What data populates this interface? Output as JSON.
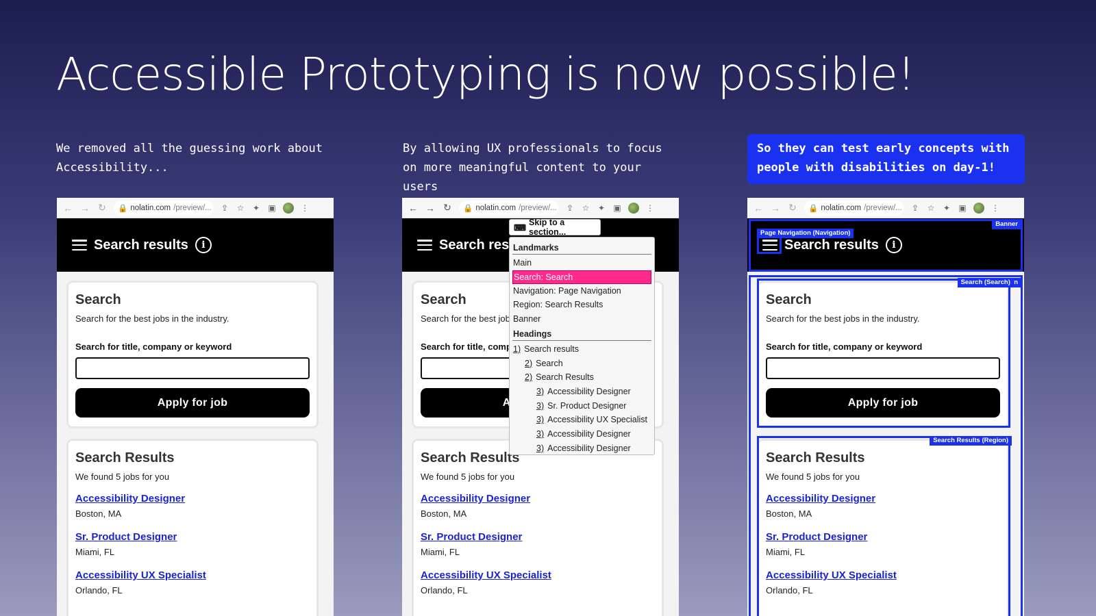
{
  "headline": "Accessible Prototyping is now possible!",
  "captions": [
    "We removed all the guessing work about Accessibility...",
    "By allowing UX professionals to focus on more meaningful content to your users",
    "So they can test early concepts with people with disabilities on day-1!"
  ],
  "browser": {
    "domain": "nolatin.com",
    "path": "/preview/..."
  },
  "app": {
    "header_title": "Search results",
    "search_heading": "Search",
    "search_desc": "Search for the best jobs in the industry.",
    "field_label": "Search for title, company or keyword",
    "apply_label": "Apply for job",
    "results_heading": "Search Results",
    "results_count": "We found 5 jobs for you",
    "jobs": [
      {
        "title": "Accessibility Designer",
        "location": "Boston, MA"
      },
      {
        "title": "Sr. Product Designer",
        "location": "Miami, FL"
      },
      {
        "title": "Accessibility UX Specialist",
        "location": "Orlando, FL"
      }
    ]
  },
  "screen_reader": {
    "skip_label": "Skip to a section...",
    "landmarks_heading": "Landmarks",
    "landmarks": [
      "Main",
      "Search: Search",
      "Navigation: Page Navigation",
      "Region: Search Results",
      "Banner"
    ],
    "active_landmark": "Search: Search",
    "headings_heading": "Headings",
    "headings": [
      {
        "level": "1)",
        "text": "Search results"
      },
      {
        "level": "2)",
        "text": "Search"
      },
      {
        "level": "2)",
        "text": "Search Results"
      },
      {
        "level": "3)",
        "text": "Accessibility Designer"
      },
      {
        "level": "3)",
        "text": "Sr. Product Designer"
      },
      {
        "level": "3)",
        "text": "Accessibility UX Specialist"
      },
      {
        "level": "3)",
        "text": "Accessibility Designer"
      },
      {
        "level": "3)",
        "text": "Accessibility Designer"
      }
    ]
  },
  "landmark_tags": {
    "banner": "Banner",
    "navigation": "Page Navigation (Navigation)",
    "search": "Search (Search)",
    "search_extra": "n",
    "region": "Search Results (Region)"
  },
  "colors": {
    "accent_blue": "#1a32f0",
    "highlight_pink": "#ff2a8c",
    "link_blue": "#1a22d6"
  }
}
